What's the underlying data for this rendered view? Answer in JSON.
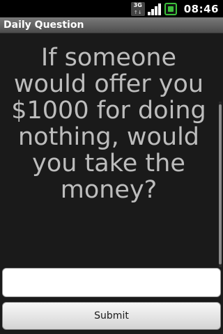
{
  "status_bar": {
    "network_label": "3G",
    "network_arrows": "↑↓",
    "time": "08:46",
    "battery_color": "#3bbf3b"
  },
  "app": {
    "title": "Daily Question"
  },
  "question": {
    "text": "If someone would offer you $1000 for doing nothing, would you take the money?"
  },
  "answer_input": {
    "value": "",
    "placeholder": ""
  },
  "submit": {
    "label": "Submit"
  }
}
